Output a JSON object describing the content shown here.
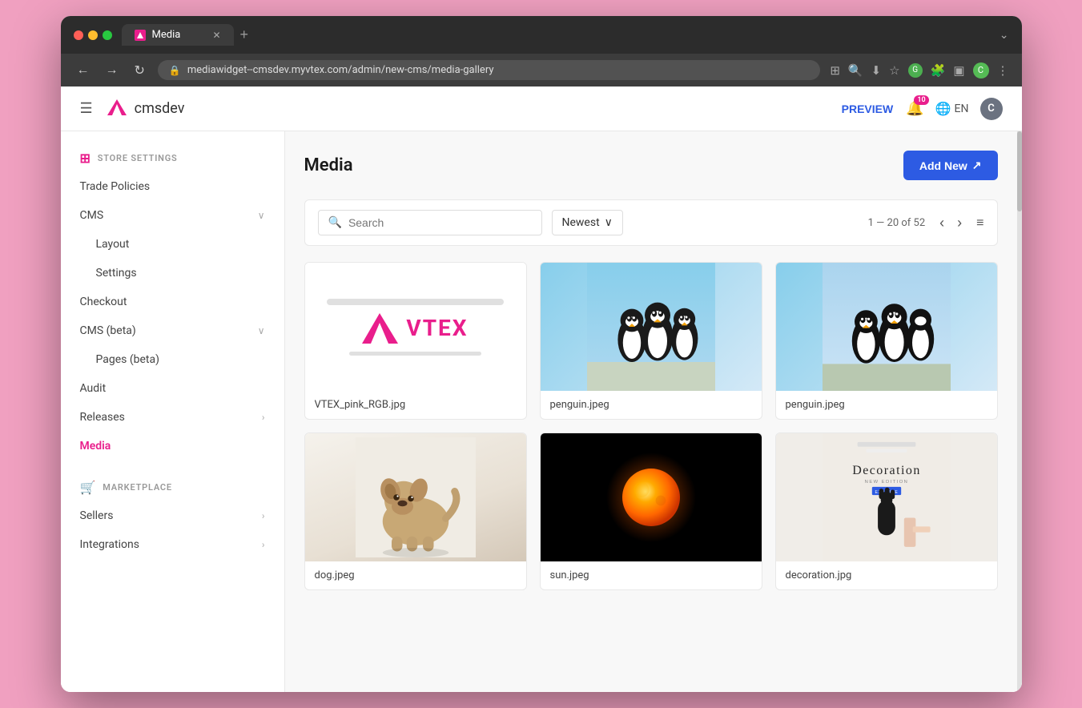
{
  "browser": {
    "tab_title": "Media",
    "url": "mediawidget--cmsdev.myvtex.com/admin/new-cms/media-gallery",
    "url_full": "mediawidget--cmsdev.myvtex.com/admin/new-cms/media-gallery"
  },
  "header": {
    "hamburger_label": "☰",
    "brand_name": "cmsdev",
    "preview_label": "PREVIEW",
    "notification_count": "10",
    "language": "EN",
    "user_initial": "C"
  },
  "sidebar": {
    "store_settings_label": "STORE SETTINGS",
    "marketplace_label": "MARKETPLACE",
    "items": [
      {
        "id": "trade-policies",
        "label": "Trade Policies",
        "sub": false,
        "expandable": false
      },
      {
        "id": "cms",
        "label": "CMS",
        "sub": false,
        "expandable": true
      },
      {
        "id": "layout",
        "label": "Layout",
        "sub": true,
        "expandable": false
      },
      {
        "id": "settings",
        "label": "Settings",
        "sub": true,
        "expandable": false
      },
      {
        "id": "checkout",
        "label": "Checkout",
        "sub": false,
        "expandable": false
      },
      {
        "id": "cms-beta",
        "label": "CMS (beta)",
        "sub": false,
        "expandable": true
      },
      {
        "id": "pages-beta",
        "label": "Pages (beta)",
        "sub": true,
        "expandable": false
      },
      {
        "id": "audit",
        "label": "Audit",
        "sub": false,
        "expandable": false
      },
      {
        "id": "releases",
        "label": "Releases",
        "sub": false,
        "expandable": true
      },
      {
        "id": "media",
        "label": "Media",
        "sub": false,
        "expandable": false,
        "active": true
      }
    ],
    "marketplace_items": [
      {
        "id": "sellers",
        "label": "Sellers",
        "expandable": true
      },
      {
        "id": "integrations",
        "label": "Integrations",
        "expandable": true
      }
    ]
  },
  "content": {
    "page_title": "Media",
    "add_new_label": "Add New",
    "search_placeholder": "Search",
    "sort_label": "Newest",
    "pagination_info": "1 — 20 of 52",
    "media_items": [
      {
        "id": "vtex-logo",
        "filename": "VTEX_pink_RGB.jpg",
        "type": "vtex"
      },
      {
        "id": "penguin-1",
        "filename": "penguin.jpeg",
        "type": "penguin"
      },
      {
        "id": "penguin-2",
        "filename": "penguin.jpeg",
        "type": "penguin"
      },
      {
        "id": "dog",
        "filename": "dog.jpeg",
        "type": "dog"
      },
      {
        "id": "sun",
        "filename": "sun.jpeg",
        "type": "sun"
      },
      {
        "id": "decoration",
        "filename": "decoration.jpg",
        "type": "decoration"
      }
    ]
  }
}
